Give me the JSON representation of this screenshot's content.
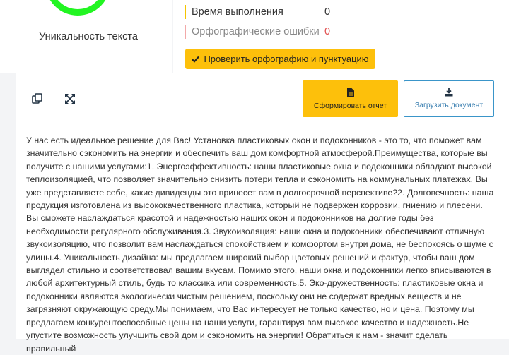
{
  "uniqueness": {
    "label": "Уникальность текста"
  },
  "stats": {
    "time_label": "Время выполнения",
    "time_value": "0",
    "errors_label": "Орфографические ошибки",
    "errors_value": "0"
  },
  "check_button": {
    "label": "Проверить орфографию и пунктуацию",
    "icon": "check-icon"
  },
  "toolbar": {
    "copy_icon": "copy-icon",
    "expand_icon": "expand-icon",
    "report_label": "Сформировать отчет",
    "upload_label": "Загрузить документ"
  },
  "colors": {
    "accent": "#fdc00b",
    "gauge": "#22f522",
    "error": "#e14d4d",
    "upload_border": "#3a95c9"
  },
  "text": {
    "body": "У нас есть идеальное решение для Вас! Установка пластиковых окон и подоконников - это то, что поможет вам значительно сэкономить на энергии и обеспечить ваш дом комфортной атмосферой.Преимущества, которые вы получите с нашими услугами:1. Энергоэффективность: наши пластиковые окна и подоконники обладают высокой теплоизоляцией, что позволяет значительно снизить потери тепла и сэкономить на коммунальных платежах. Вы уже представляете себе, какие дивиденды это принесет вам в долгосрочной перспективе?2. Долговечность: наша продукция изготовлена из высококачественного пластика, который не подвержен коррозии, гниению и плесени. Вы сможете наслаждаться красотой и надежностью наших окон и подоконников на долгие годы без необходимости регулярного обслуживания.3. Звукоизоляция: наши окна и подоконники обеспечивают отличную звукоизоляцию, что позволит вам наслаждаться спокойствием и комфортом внутри дома, не беспокоясь о шуме с улицы.4. Уникальность дизайна: мы предлагаем широкий выбор цветовых решений и фактур, чтобы ваш дом выглядел стильно и соответствовал вашим вкусам. Помимо этого, наши окна и подоконники легко вписываются в любой архитектурный стиль, будь то классика или современность.5. Эко-дружественность: пластиковые окна и подоконники являются экологически чистым решением, поскольку они не содержат вредных веществ и не загрязняют окружающую среду.Мы понимаем, что Вас интересует не только качество, но и цена. Поэтому мы предлагаем конкурентоспособные цены на наши услуги, гарантируя вам высокое качество и надежность.Не упустите возможность улучшить свой дом и сэкономить на энергии! Обратиться к нам - значит сделать правильный"
  }
}
